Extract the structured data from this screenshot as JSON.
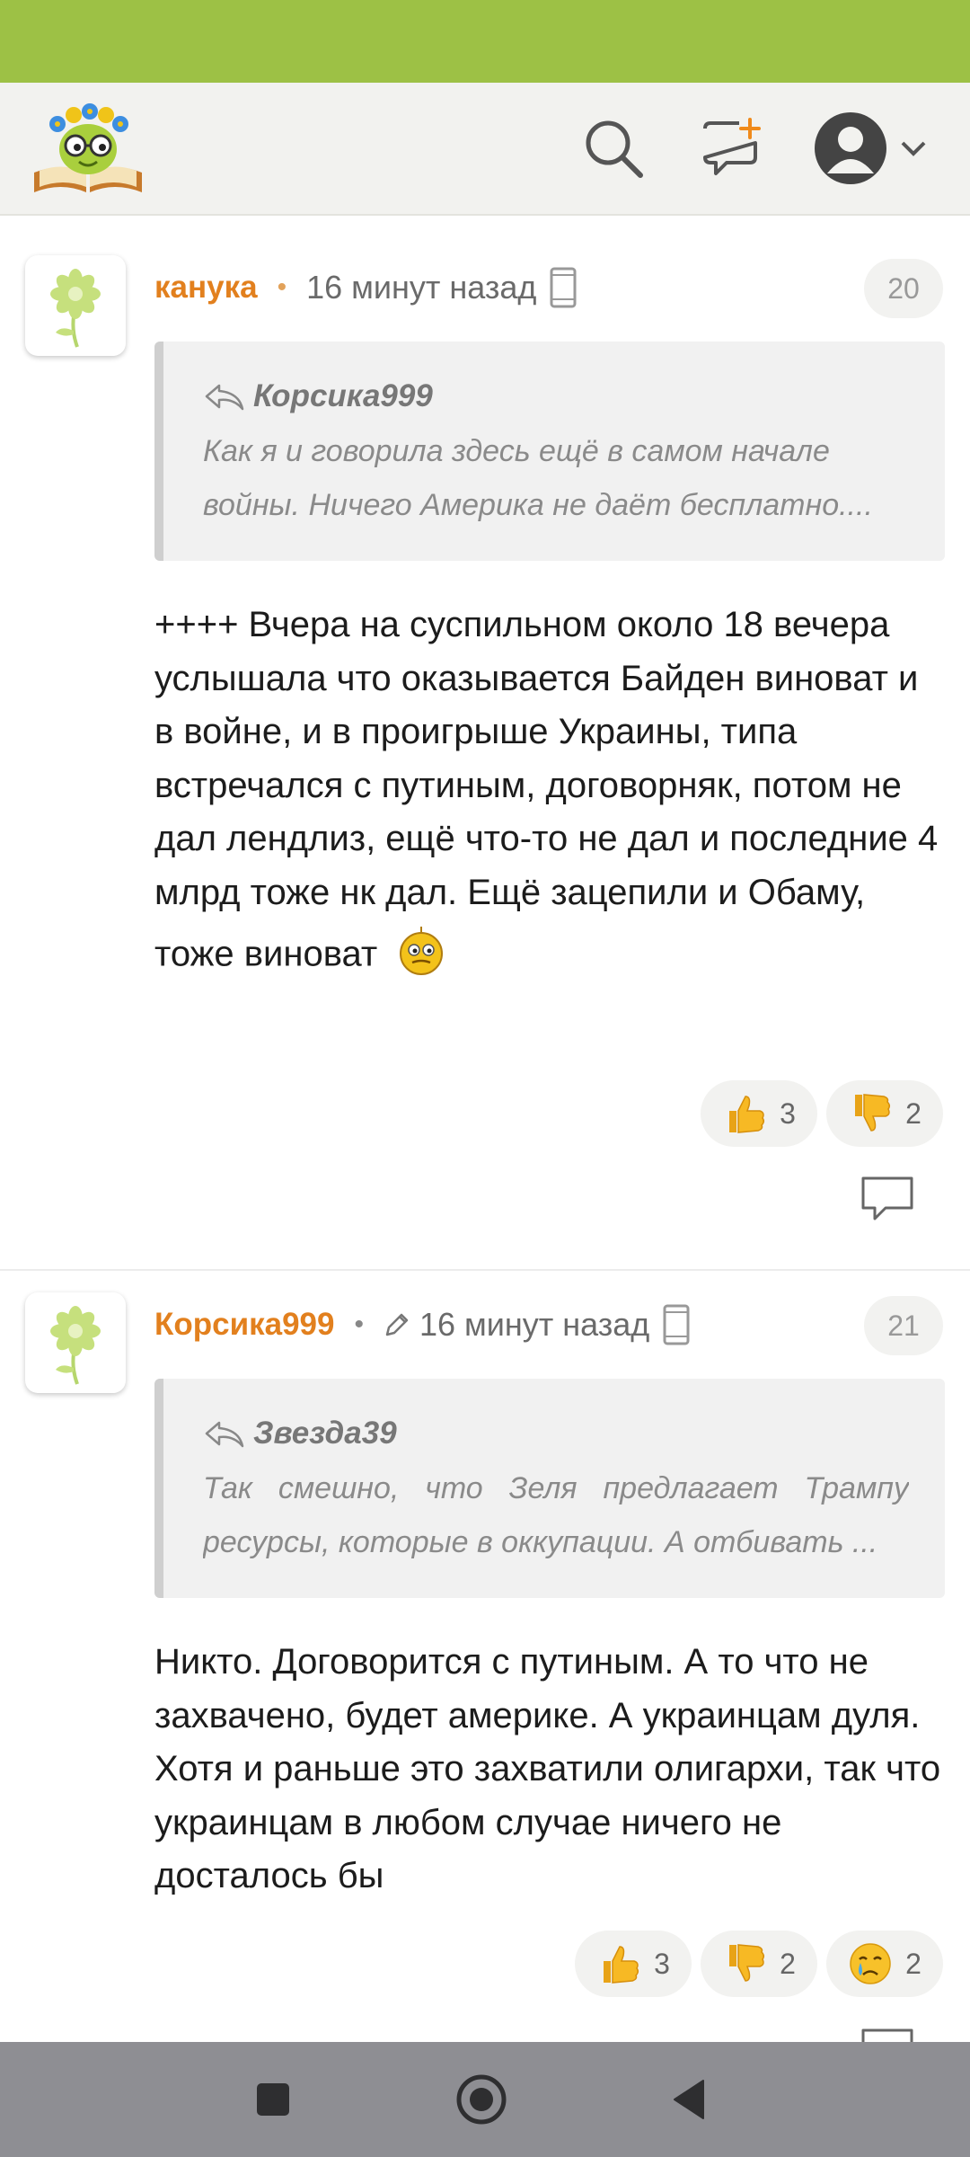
{
  "app": {
    "logo_icon": "reading-flower-logo",
    "colors": {
      "status_bar": "#9dc145",
      "author": "#e2801e",
      "header_bg": "#f2f2ef",
      "nav_bar": "#8e8e93"
    }
  },
  "comments": [
    {
      "author": "канука",
      "time": "16 минут назад",
      "edited": false,
      "number": "20",
      "quote": {
        "author": "Корсика999",
        "text": "Как я и говорила здесь ещё в самом начале войны. Ничего Америка не даёт бесплатно...."
      },
      "text": "++++ Вчера на суспильном около 18 вечера услышала что оказывается Байден виноват и в войне, и в проигрыше Украины, типа встречался с путиным, договорняк, потом не дал лендлиз, ещё что-то не дал и последние 4 млрд тоже нк дал. Ещё зацепили и Обаму, тоже виноват",
      "reactions": [
        {
          "icon": "thumbs-up-emoji",
          "count": "3"
        },
        {
          "icon": "thumbs-down-emoji",
          "count": "2"
        }
      ]
    },
    {
      "author": "Корсика999",
      "time": "16 минут назад",
      "edited": true,
      "number": "21",
      "quote": {
        "author": "Звезда39",
        "text": "Так смешно, что Зеля предлагает Трампу ресурсы, которые в оккупации. А отбивать ..."
      },
      "text": "Никто. Договорится с путиным. А то что не захвачено, будет америке. А украинцам дуля. Хотя и раньше это захватили олигархи, так что украинцам в любом случае ничего не досталось бы",
      "reactions": [
        {
          "icon": "thumbs-up-emoji",
          "count": "3"
        },
        {
          "icon": "thumbs-down-emoji",
          "count": "2"
        },
        {
          "icon": "crying-face-emoji",
          "count": "2"
        }
      ]
    }
  ]
}
